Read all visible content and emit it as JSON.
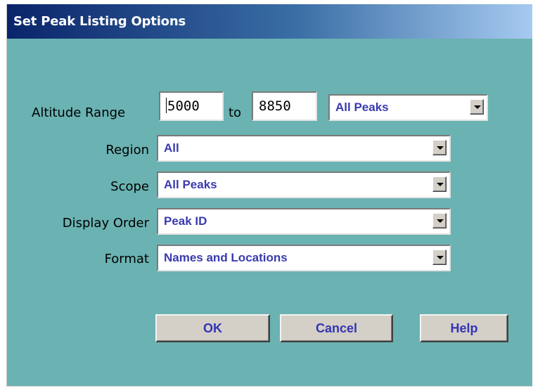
{
  "window": {
    "title": "Set Peak Listing Options"
  },
  "altitude": {
    "label": "Altitude Range",
    "from_value": "5000",
    "to_label": "to",
    "to_value": "8850",
    "filter_value": "All Peaks"
  },
  "fields": {
    "region": {
      "label": "Region",
      "value": "All"
    },
    "scope": {
      "label": "Scope",
      "value": "All Peaks"
    },
    "display_order": {
      "label": "Display Order",
      "value": "Peak ID"
    },
    "format": {
      "label": "Format",
      "value": "Names and Locations"
    }
  },
  "buttons": {
    "ok": "OK",
    "cancel": "Cancel",
    "help": "Help"
  },
  "icons": {
    "dropdown": "chevron-down-icon"
  },
  "colors": {
    "title_gradient_start": "#0a246a",
    "title_gradient_end": "#a6caf0",
    "dialog_background": "#6bb2b2",
    "combo_text": "#3a3ab0",
    "button_text": "#3434b4",
    "button_face": "#d4d0c8"
  }
}
